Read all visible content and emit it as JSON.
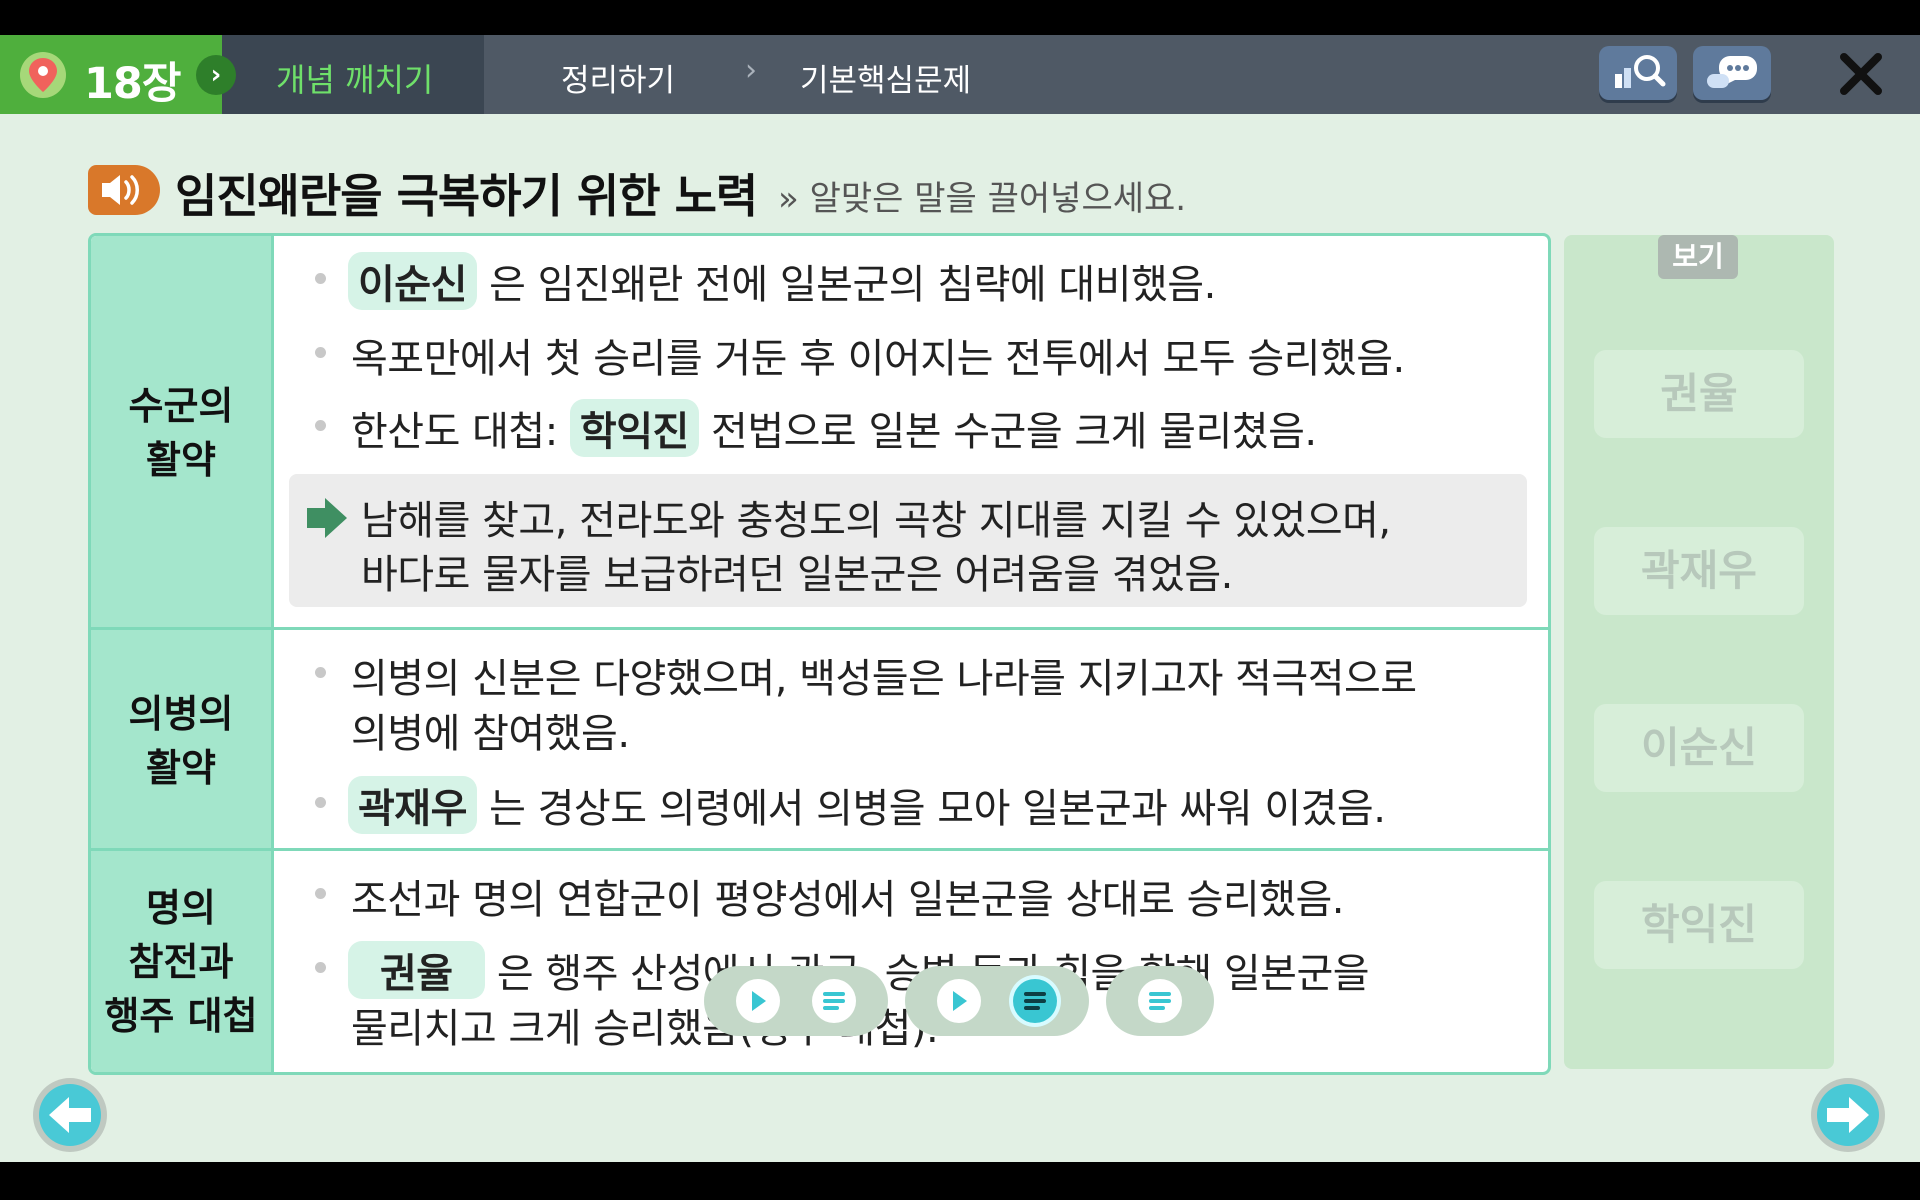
{
  "header": {
    "chapter": "18장",
    "nav": [
      "개념 깨치기",
      "정리하기",
      "기본핵심문제"
    ],
    "buttons": [
      "search-icon",
      "chat-icon",
      "close-icon"
    ]
  },
  "section": {
    "title": "임진왜란을 극복하기 위한 노력",
    "instruction": "» 알맞은 말을 끌어넣으세요."
  },
  "rows": [
    {
      "category": "수군의\n활약",
      "line1": {
        "blank": "이순신",
        "text": " 은 임진왜란 전에 일본군의 침략에 대비했음."
      },
      "line2": "옥포만에서 첫 승리를 거둔 후 이어지는 전투에서 모두 승리했음.",
      "line3": {
        "prefix": "한산도 대첩: ",
        "blank": "학익진",
        "suffix": "  전법으로 일본 수군을 크게 물리쳤음."
      },
      "summary": [
        "남해를 찾고, 전라도와 충청도의 곡창 지대를 지킬 수 있었으며,",
        "바다로 물자를 보급하려던 일본군은 어려움을 겪었음."
      ]
    },
    {
      "category": "의병의\n활약",
      "line1a": "의병의 신분은 다양했으며, 백성들은 나라를 지키고자 적극적으로",
      "line1b": "의병에 참여했음.",
      "line2": {
        "blank": "곽재우",
        "text": " 는 경상도 의령에서 의병을 모아 일본군과 싸워 이겼음."
      }
    },
    {
      "category": "명의\n참전과\n행주 대첩",
      "line1": "조선과 명의 연합군이 평양성에서 일본군을 상대로 승리했음.",
      "line2": {
        "blank": "권율",
        "text": " 은 행주 산성에서 관군, 승병 등과 힘을 합해 일본군을"
      },
      "line2b": "물리치고 크게 승리했음(행주 대첩)."
    }
  ],
  "options": {
    "label": "보기",
    "items": [
      "권율",
      "곽재우",
      "이순신",
      "학익진"
    ]
  },
  "colors": {
    "accent_green": "#4faf3d",
    "mint": "#a4e6cc",
    "cyan": "#49c9d6"
  }
}
